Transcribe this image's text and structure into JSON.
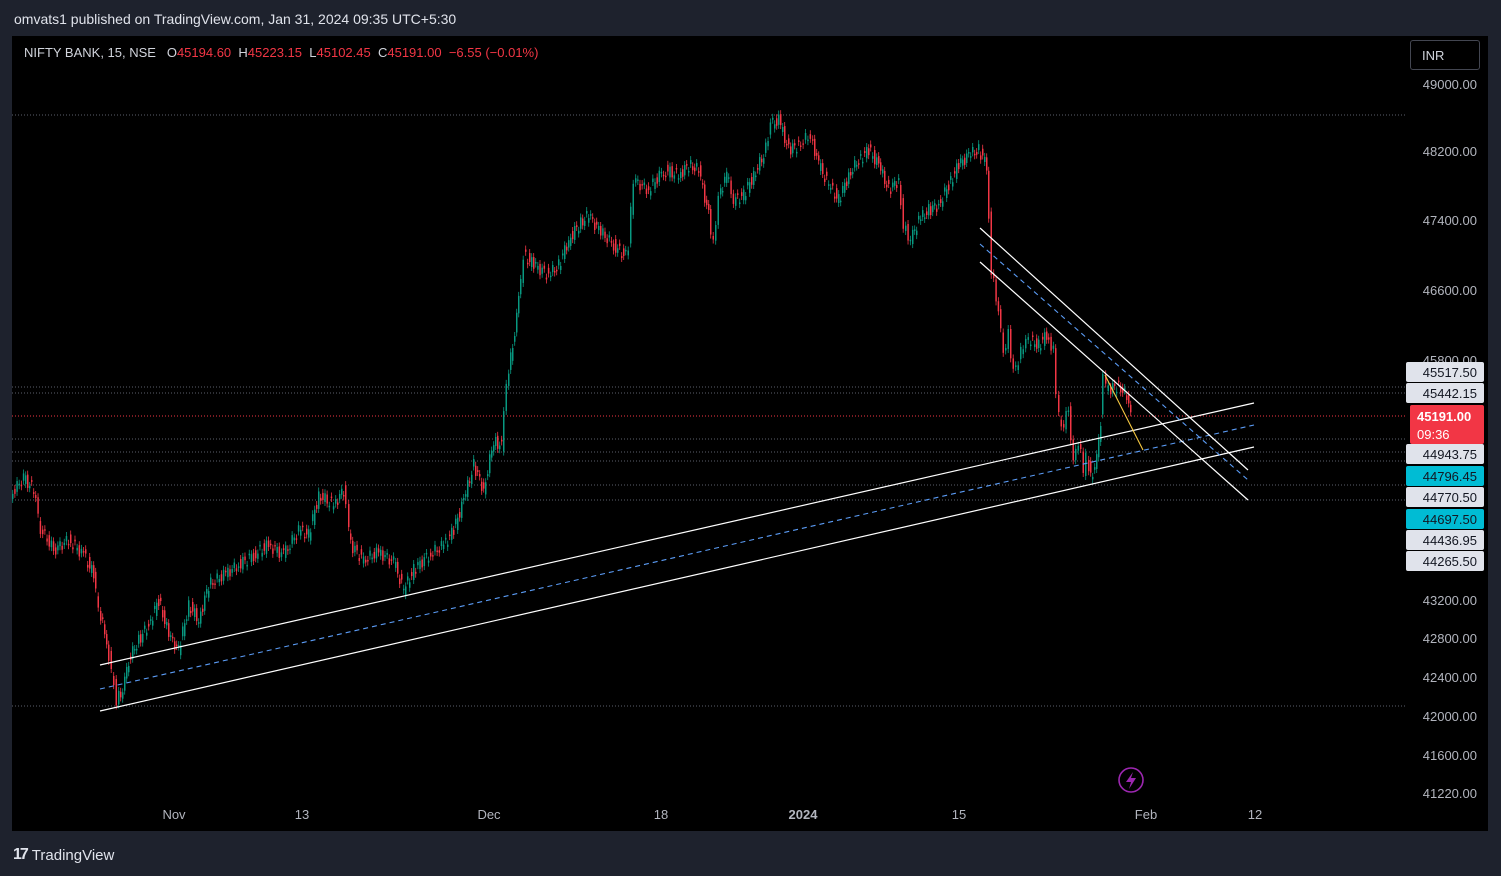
{
  "header": {
    "published_text": "omvats1 published on TradingView.com, Jan 31, 2024 09:35 UTC+5:30"
  },
  "legend": {
    "symbol": "NIFTY BANK, 15, NSE",
    "open_label": "O",
    "open": "45194.60",
    "high_label": "H",
    "high": "45223.15",
    "low_label": "L",
    "low": "45102.45",
    "close_label": "C",
    "close": "45191.00",
    "change": "−6.55 (−0.01%)"
  },
  "currency_button": "INR",
  "price_axis": {
    "ticks": [
      "49000.00",
      "48200.00",
      "47400.00",
      "46600.00",
      "45800.00",
      "43200.00",
      "42800.00",
      "42400.00",
      "42000.00",
      "41600.00",
      "41220.00"
    ],
    "price_labels": [
      {
        "text": "45517.50",
        "bg": "#e0e3eb",
        "fg": "#131722"
      },
      {
        "text": "45442.15",
        "bg": "#e0e3eb",
        "fg": "#131722"
      },
      {
        "text": "44943.75",
        "bg": "#e0e3eb",
        "fg": "#131722"
      },
      {
        "text": "44796.45",
        "bg": "#00bcd4",
        "fg": "#131722"
      },
      {
        "text": "44770.50",
        "bg": "#e0e3eb",
        "fg": "#131722"
      },
      {
        "text": "44697.50",
        "bg": "#00bcd4",
        "fg": "#131722"
      },
      {
        "text": "44436.95",
        "bg": "#e0e3eb",
        "fg": "#131722"
      },
      {
        "text": "44265.50",
        "bg": "#e0e3eb",
        "fg": "#131722"
      }
    ],
    "current_price": {
      "price": "45191.00",
      "time": "09:36",
      "bg": "#f23645"
    }
  },
  "time_axis": {
    "labels": [
      "Nov",
      "13",
      "Dec",
      "18",
      "2024",
      "15",
      "Feb",
      "12"
    ]
  },
  "colors": {
    "up": "#089981",
    "down": "#f23645",
    "trendline": "#ffffff",
    "midline": "#5b9cf6",
    "yellow_line": "#f5c842",
    "lightning": "#9c27b0"
  },
  "footer": {
    "brand": "TradingView"
  },
  "icons": {
    "lightning": "lightning-icon",
    "logo": "tradingview-logo-icon"
  }
}
